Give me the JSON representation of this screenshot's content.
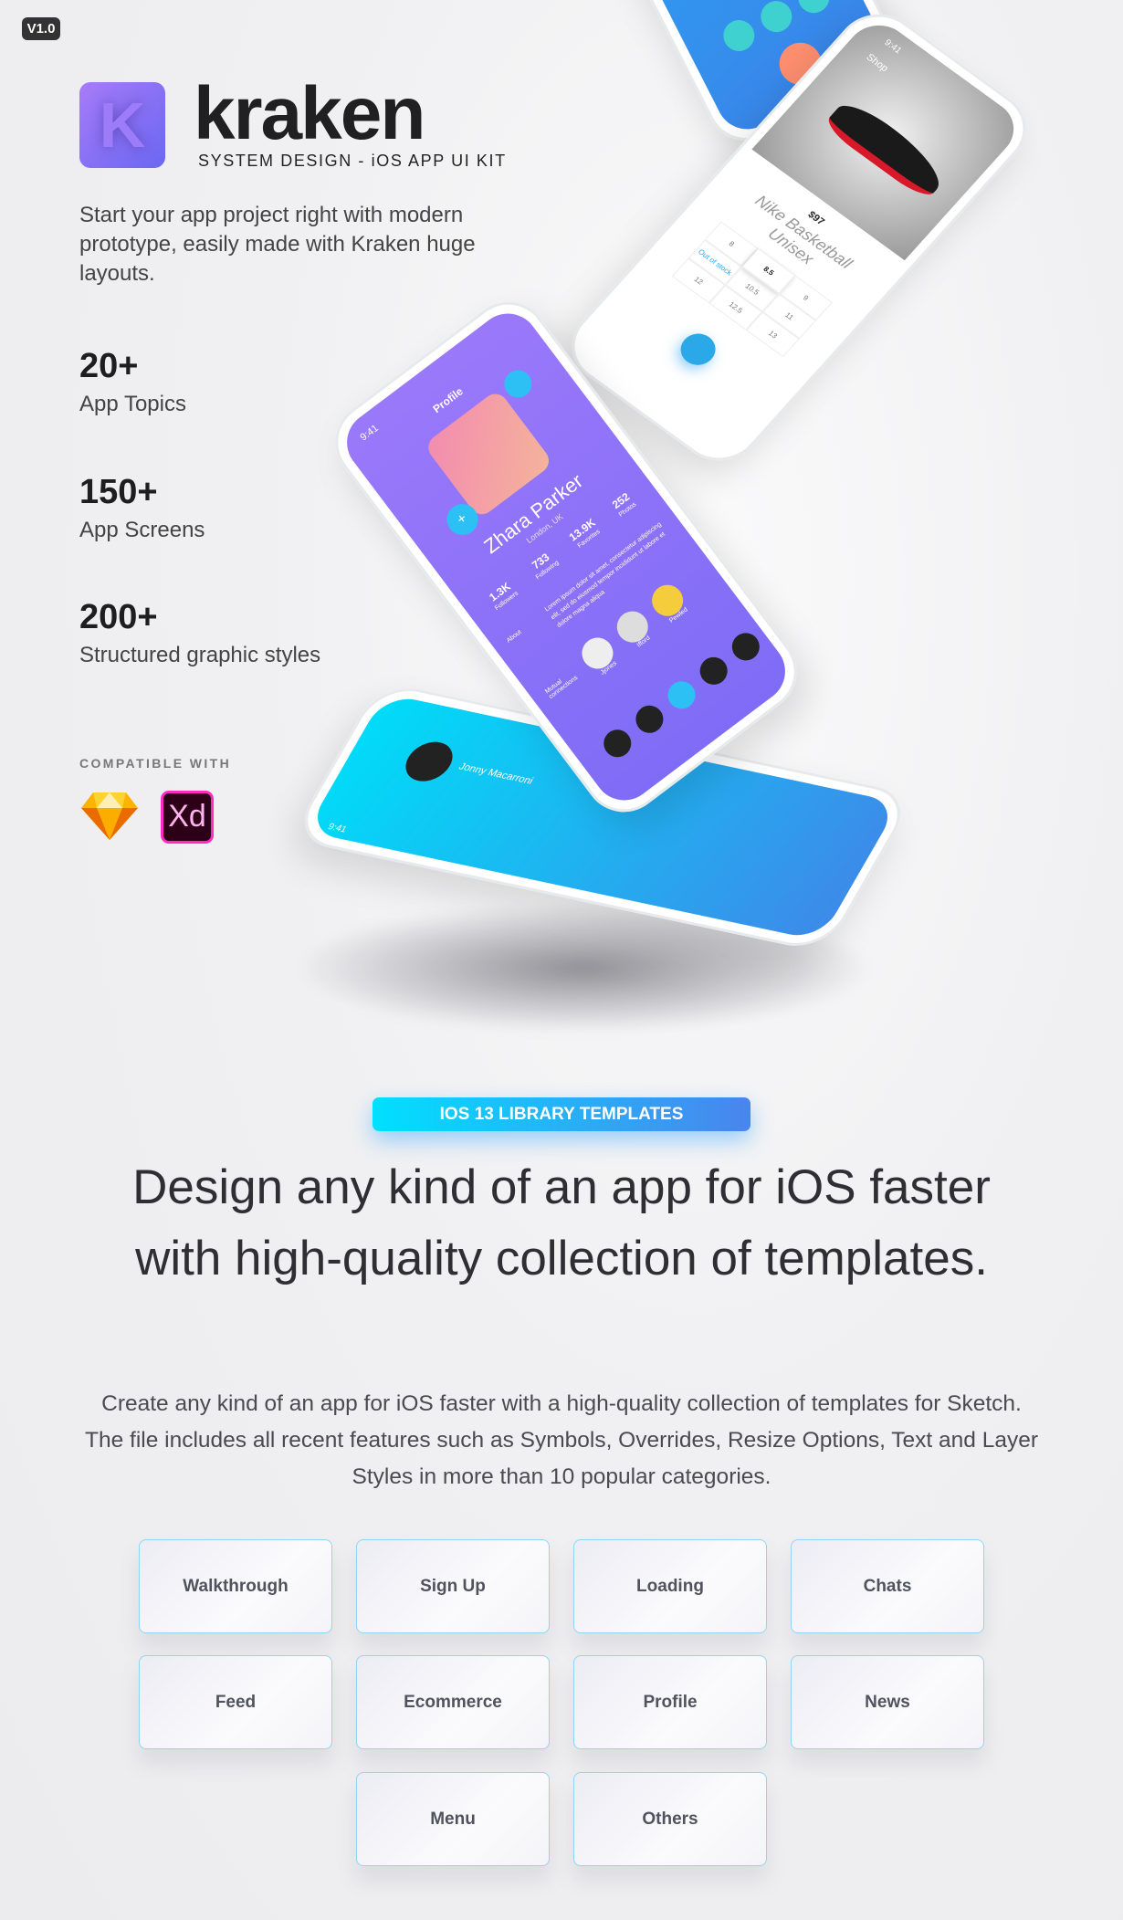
{
  "version_badge": "V1.0",
  "logo": {
    "letter": "K",
    "brand": "kraken",
    "tagline": "SYSTEM DESIGN - iOS APP UI KIT"
  },
  "intro": "Start your app project right with modern prototype, easily made with Kraken huge layouts.",
  "stats": [
    {
      "value": "20+",
      "label": "App Topics"
    },
    {
      "value": "150+",
      "label": "App Screens"
    },
    {
      "value": "200+",
      "label": "Structured graphic styles"
    }
  ],
  "compatible": {
    "label": "COMPATIBLE WITH",
    "apps": [
      "sketch-icon",
      "xd-icon"
    ],
    "xd_text": "Xd"
  },
  "mockups": {
    "profile": {
      "title": "Profile",
      "time": "9:41",
      "name": "Zhara Parker",
      "location": "London, UK",
      "stats": [
        {
          "v": "1.3K",
          "l": "Followers"
        },
        {
          "v": "733",
          "l": "Following"
        },
        {
          "v": "13.9K",
          "l": "Favorites"
        },
        {
          "v": "252",
          "l": "Photos"
        }
      ],
      "about_label": "About",
      "about": "Lorem ipsum dolor sit amet, consectetur adipiscing elit, sed do eiusmod tempor incididunt ut labore et dolore magna aliqua",
      "mutual_label": "Mutual connections",
      "connections": [
        "Jjones",
        "Ifford",
        "Pewled"
      ]
    },
    "shop": {
      "time": "9:41",
      "back": "Shop",
      "price": "$97",
      "product": "Nike Basketball Unisex",
      "sizes": [
        "8",
        "8.5",
        "9",
        "Out of stock",
        "10.5",
        "11",
        "12",
        "12.5",
        "13"
      ],
      "selected_size": "8.5"
    },
    "menu": {
      "time": "9:41",
      "user": "Jonny Macarroni"
    }
  },
  "colors": {
    "purple": "#8a6cf7",
    "cyan": "#00d8f8",
    "blue": "#3e8ee9",
    "border": "#8fd5f4"
  },
  "section": {
    "badge": "IOS 13 LIBRARY TEMPLATES",
    "headline": "Design any kind of an app for iOS faster with high-quality collection of templates.",
    "paragraph": "Create any kind of an app for iOS faster with a high-quality collection of templates for Sketch. The file includes all recent features such as Symbols, Overrides, Resize Options, Text and Layer Styles in more than 10 popular categories."
  },
  "categories": [
    "Walkthrough",
    "Sign Up",
    "Loading",
    "Chats",
    "Feed",
    "Ecommerce",
    "Profile",
    "News",
    "Menu",
    "Others"
  ]
}
